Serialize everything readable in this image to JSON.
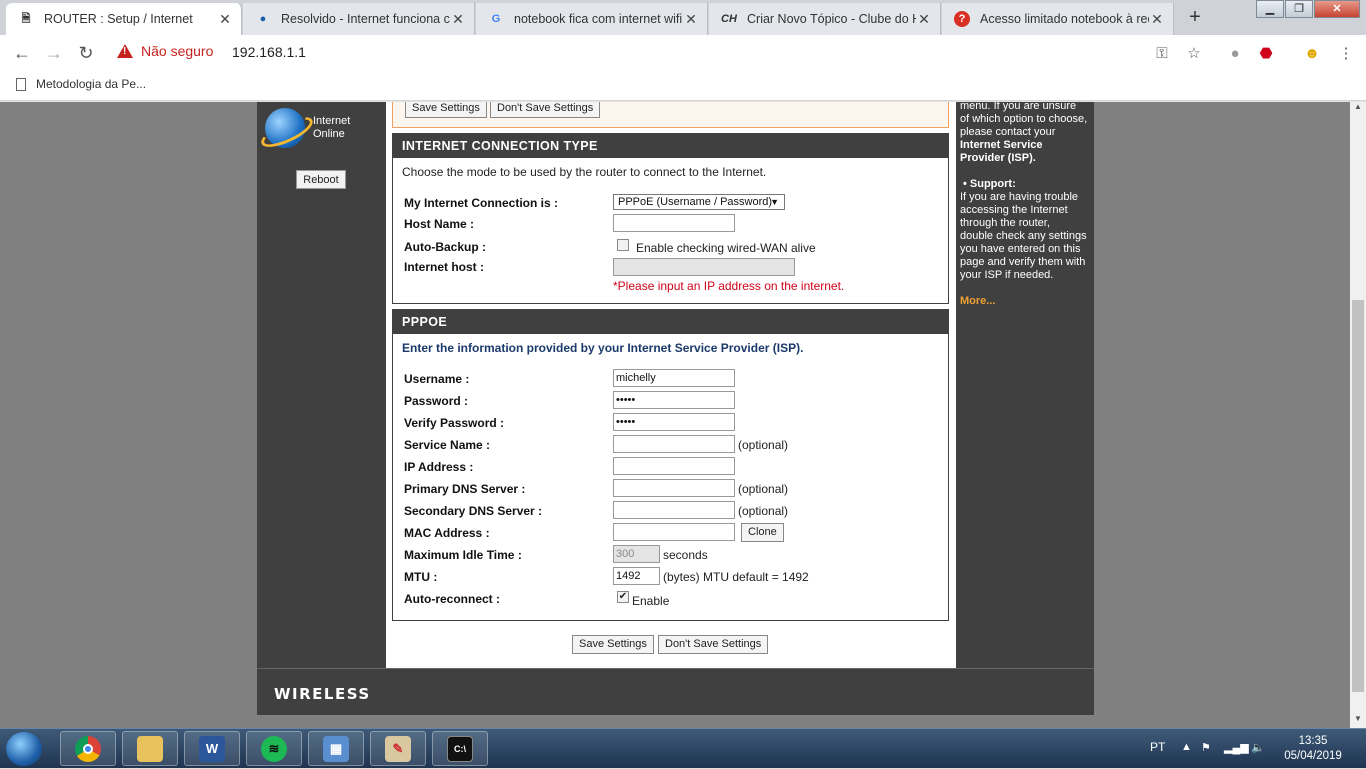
{
  "browser": {
    "tabs": [
      {
        "title": "ROUTER : Setup / Internet",
        "active": true,
        "icon": "document-icon"
      },
      {
        "title": "Resolvido - Internet funciona co",
        "active": false,
        "icon": "site-icon"
      },
      {
        "title": "notebook fica com internet wifi",
        "active": false,
        "icon": "google-icon"
      },
      {
        "title": "Criar Novo Tópico - Clube do H",
        "active": false,
        "icon": "ch-icon"
      },
      {
        "title": "Acesso limitado notebook à red",
        "active": false,
        "icon": "question-icon"
      }
    ],
    "security_label": "Não seguro",
    "url": "192.168.1.1",
    "bookmark": "Metodologia da Pe...",
    "new_tab": "+"
  },
  "router": {
    "status": {
      "line1": "Internet",
      "line2": "Online"
    },
    "reboot_label": "Reboot",
    "top_buttons": {
      "save": "Save Settings",
      "dont_save": "Don't Save Settings"
    },
    "connection_type": {
      "header": "INTERNET CONNECTION TYPE",
      "description": "Choose the mode to be used by the router to connect to the Internet.",
      "connection_label": "My Internet Connection is :",
      "connection_value": "PPPoE (Username / Password)",
      "host_name_label": "Host Name :",
      "host_name_value": "",
      "auto_backup_label": "Auto-Backup :",
      "auto_backup_option": "Enable checking wired-WAN alive",
      "auto_backup_checked": false,
      "internet_host_label": "Internet host :",
      "internet_host_value": "",
      "error": "*Please input an IP address on the internet."
    },
    "pppoe": {
      "header": "PPPOE",
      "description": "Enter the information provided by your Internet Service Provider (ISP).",
      "username_label": "Username :",
      "username_value": "michelly",
      "password_label": "Password :",
      "password_value": "•••••",
      "verify_label": "Verify Password :",
      "verify_value": "•••••",
      "service_label": "Service Name :",
      "ip_label": "IP Address :",
      "primary_dns_label": "Primary DNS Server :",
      "secondary_dns_label": "Secondary DNS Server :",
      "mac_label": "MAC Address :",
      "clone_label": "Clone",
      "idle_label": "Maximum Idle Time :",
      "idle_value": "300",
      "idle_unit": "seconds",
      "mtu_label": "MTU :",
      "mtu_value": "1492",
      "mtu_note": "(bytes) MTU default = 1492",
      "reconnect_label": "Auto-reconnect :",
      "reconnect_option": "Enable",
      "reconnect_checked": true,
      "optional": "(optional)"
    },
    "bottom_buttons": {
      "save": "Save Settings",
      "dont_save": "Don't Save Settings"
    },
    "help": {
      "intro_l1": "menu. If you are unsure",
      "intro_l2": "of which option to choose,",
      "intro_l3": "please contact your",
      "intro_bold1": "Internet Service",
      "intro_bold2": "Provider (ISP).",
      "support_title": "• Support:",
      "support_l1": "If you are having trouble",
      "support_l2": "accessing the Internet",
      "support_l3": "through the router,",
      "support_l4": "double check any settings",
      "support_l5": "you have entered on this",
      "support_l6": "page and verify them with",
      "support_l7": "your ISP if needed.",
      "more": "More..."
    },
    "footer_brand": "WIRELESS"
  },
  "taskbar": {
    "language": "PT",
    "time": "13:35",
    "date": "05/04/2019",
    "apps": [
      "chrome-icon",
      "explorer-icon",
      "word-icon",
      "spotify-icon",
      "control-panel-icon",
      "paint-icon",
      "cmd-icon"
    ]
  }
}
